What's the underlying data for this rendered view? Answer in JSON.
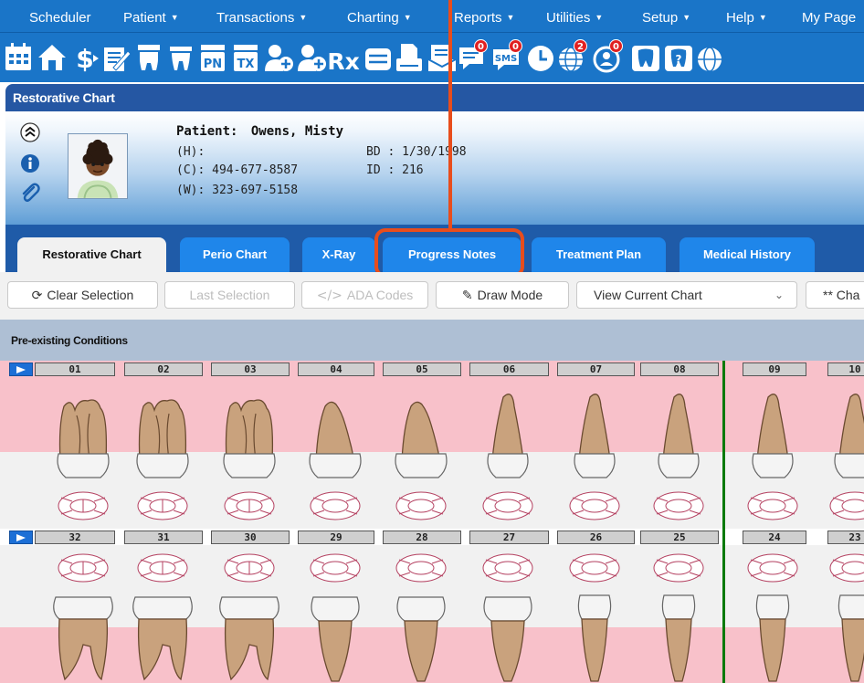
{
  "menu": [
    {
      "label": "Scheduler",
      "caret": false
    },
    {
      "label": "Patient",
      "caret": true
    },
    {
      "label": "Transactions",
      "caret": true
    },
    {
      "label": "Charting",
      "caret": true
    },
    {
      "label": "Reports",
      "caret": true
    },
    {
      "label": "Utilities",
      "caret": true
    },
    {
      "label": "Setup",
      "caret": true
    },
    {
      "label": "Help",
      "caret": true
    },
    {
      "label": "My Page",
      "caret": false
    }
  ],
  "caret_glyph": "▼",
  "toolbar": {
    "icons": [
      {
        "name": "calendar-icon"
      },
      {
        "name": "home-icon"
      },
      {
        "name": "dollar-icon"
      },
      {
        "name": "edit-note-icon"
      },
      {
        "name": "tooth-chart-icon"
      },
      {
        "name": "perio-tooth-icon"
      },
      {
        "name": "progress-notes-icon",
        "text": "PN"
      },
      {
        "name": "treatment-plan-icon",
        "text": "TX"
      },
      {
        "name": "add-patient-icon"
      },
      {
        "name": "add-patient-alt-icon"
      },
      {
        "name": "prescription-icon",
        "text": "Rx"
      },
      {
        "name": "lab-case-icon"
      },
      {
        "name": "print-icon"
      },
      {
        "name": "documents-icon"
      },
      {
        "name": "messages-icon",
        "badge": "0"
      },
      {
        "name": "sms-icon",
        "text": "SMS",
        "badge": "0"
      },
      {
        "name": "clock-icon"
      },
      {
        "name": "globe-icon",
        "badge": "2"
      },
      {
        "name": "patient-portal-icon",
        "badge": "0"
      },
      {
        "name": "tooth-icon"
      },
      {
        "name": "help-tooth-icon"
      },
      {
        "name": "globe-more-icon"
      }
    ]
  },
  "title": "Restorative Chart",
  "patient": {
    "name_label": "Patient:",
    "name": "Owens, Misty",
    "home_phone": "(H):",
    "cell_phone": "(C):  494-677-8587",
    "work_phone": "(W): 323-697-5158",
    "birth_date": "BD : 1/30/1998",
    "id": "ID : 216"
  },
  "tabs": [
    {
      "label": "Restorative Chart",
      "active": true
    },
    {
      "label": "Perio Chart",
      "active": false
    },
    {
      "label": "X-Ray",
      "active": false
    },
    {
      "label": "Progress Notes",
      "active": false
    },
    {
      "label": "Treatment Plan",
      "active": false
    },
    {
      "label": "Medical History",
      "active": false
    }
  ],
  "actions": {
    "clear_selection": "Clear Selection",
    "last_selection": "Last Selection",
    "ada_codes": "ADA Codes",
    "draw_mode": "Draw Mode",
    "view_select": "View Current Chart",
    "extra": "** Cha"
  },
  "chart": {
    "section_label": "Pre-existing Conditions",
    "upper_teeth": [
      "01",
      "02",
      "03",
      "04",
      "05",
      "06",
      "07",
      "08",
      "09",
      "10"
    ],
    "lower_teeth": [
      "32",
      "31",
      "30",
      "29",
      "28",
      "27",
      "26",
      "25",
      "24",
      "23"
    ]
  },
  "colors": {
    "menu_blue": "#1a75c8",
    "tab_blue": "#1f86ea",
    "highlight": "#e84d1c",
    "gum_pink": "#f8c1ca",
    "midline_green": "#0a7a0a"
  }
}
